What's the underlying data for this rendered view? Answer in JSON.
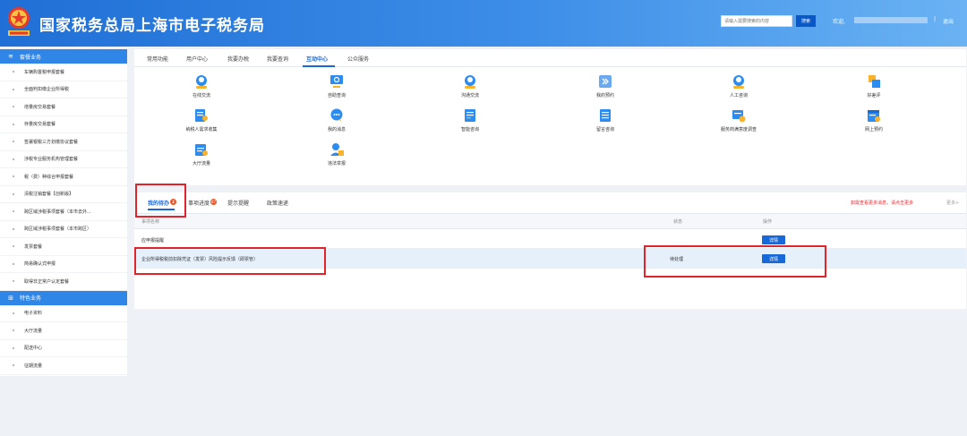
{
  "header": {
    "site_title": "国家税务总局上海市电子税务局",
    "search_placeholder": "请输入需要搜索的内容",
    "search_button": "搜索",
    "welcome": "欢迎,",
    "separator": "|",
    "logout": "退出"
  },
  "sidebar": {
    "section1": "套餐业务",
    "items1": [
      "车辆购置税申报套餐",
      "全面判扣缴企业所得税",
      "增量房交易套餐",
      "存量房交易套餐",
      "签署银税三方划缴协议套餐",
      "涉税专业服务机构管理套餐",
      "税（费）种综合申报套餐",
      "清税注销套餐【创新版】",
      "跨区域涉税事项套餐（本市去外...",
      "跨区域涉税事项套餐（本市跨区）",
      "发票套餐",
      "简易确认式申报",
      "取得非正常户认定套餐"
    ],
    "section2": "特色业务",
    "items2": [
      "电子资料",
      "大厅流量",
      "配送中心",
      "征期流量"
    ]
  },
  "main": {
    "tabs": [
      "常用功能",
      "用户中心",
      "我要办税",
      "我要查询",
      "互动中心",
      "公众服务"
    ],
    "active_tab": "互动中心",
    "services": [
      "在线交流",
      "自助查询",
      "沟通交流",
      "我的预约",
      "人工咨询",
      "好差评",
      "纳税人需求收集",
      "我的消息",
      "智能咨询",
      "留言咨询",
      "服务商满意度调查",
      "网上预约",
      "大厅流量",
      "违法举报"
    ]
  },
  "todo": {
    "tabs": [
      {
        "label": "我的待办",
        "badge": "2"
      },
      {
        "label": "事项进度",
        "badge": "87"
      },
      {
        "label": "提示提醒",
        "badge": ""
      },
      {
        "label": "政策速递",
        "badge": ""
      }
    ],
    "notice": "如需查看更多消息，请点击更多",
    "more": "更多>",
    "columns": [
      "事项名称",
      "状态",
      "操作"
    ],
    "rows": [
      {
        "name": "应申报提醒",
        "status": "",
        "action": "详情"
      },
      {
        "name": "企业所得税税前扣除凭证（发票）风险提示反馈（即票管）",
        "status": "待处理",
        "action": "详情"
      }
    ]
  },
  "colors": {
    "header_start": "#1f6fd6",
    "header_end": "#6ab2f3",
    "accent": "#1768d8",
    "highlight": "#e0242b",
    "badge": "#f4511e"
  }
}
